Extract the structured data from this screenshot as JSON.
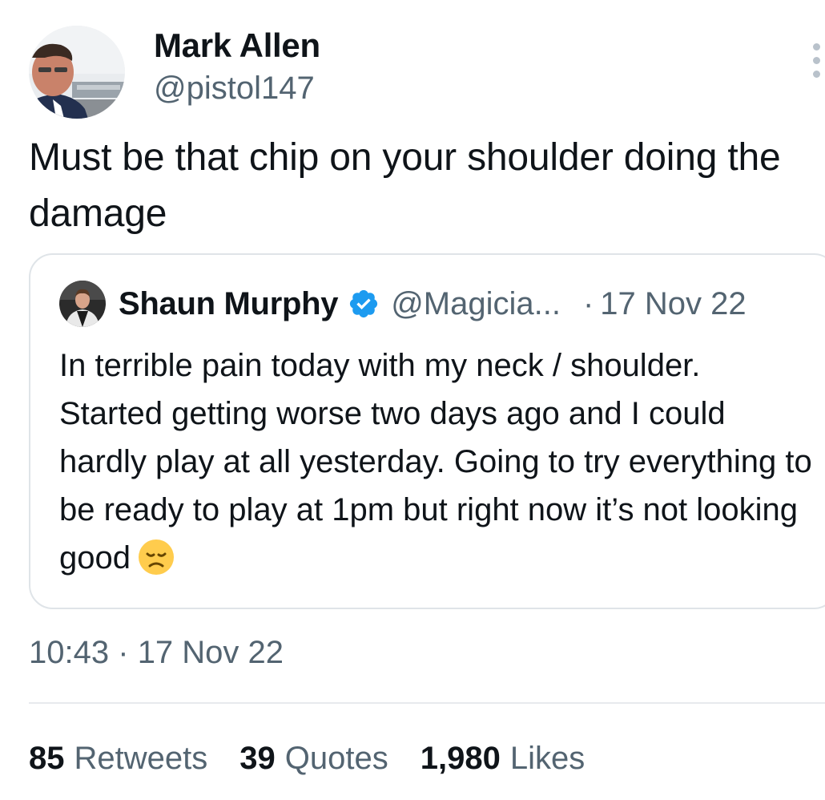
{
  "author": {
    "name": "Mark Allen",
    "handle": "@pistol147"
  },
  "tweet": {
    "text": "Must be that chip on your shoulder doing the damage",
    "time": "10:43",
    "separator": "·",
    "date": "17 Nov 22"
  },
  "quoted_tweet": {
    "name": "Shaun Murphy",
    "verified": true,
    "handle": "@Magicia...",
    "separator": "·",
    "date": "17 Nov 22",
    "text": "In terrible pain today with my neck / shoulder. Started getting worse two days ago and I could hardly play at all yesterday. Going to try everything to be ready to play at 1pm but right now it’s not looking good",
    "emoji": "disappointed-face-icon"
  },
  "stats": {
    "retweets": {
      "count": "85",
      "label": "Retweets"
    },
    "quotes": {
      "count": "39",
      "label": "Quotes"
    },
    "likes": {
      "count": "1,980",
      "label": "Likes"
    }
  },
  "colors": {
    "text_primary": "#0f1419",
    "text_secondary": "#536471",
    "verified_blue": "#1d9bf0",
    "border": "#dfe4e8"
  }
}
